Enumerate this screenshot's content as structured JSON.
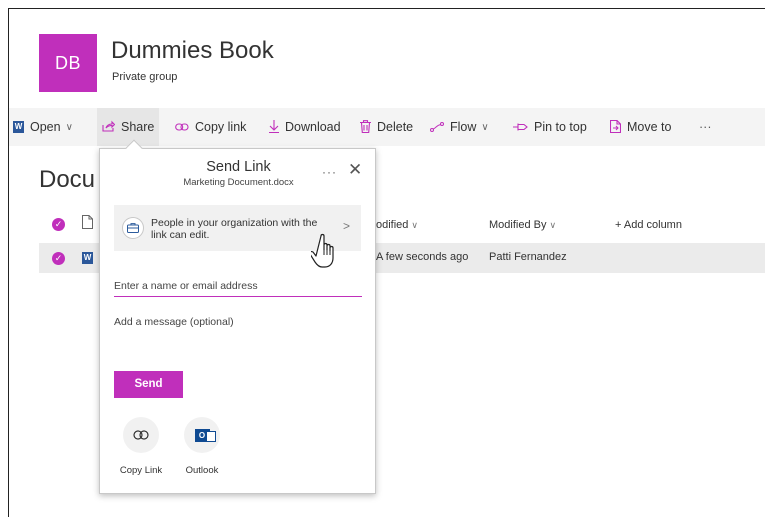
{
  "site": {
    "logo_initials": "DB",
    "title": "Dummies Book",
    "subtitle": "Private group",
    "brand_color": "#c02fbb"
  },
  "commandbar": {
    "open": {
      "label": "Open",
      "icon": "word-doc-icon"
    },
    "share": {
      "label": "Share",
      "icon": "share-icon"
    },
    "copy_link": {
      "label": "Copy link",
      "icon": "link-icon"
    },
    "download": {
      "label": "Download",
      "icon": "download-icon"
    },
    "delete": {
      "label": "Delete",
      "icon": "trash-icon"
    },
    "flow": {
      "label": "Flow",
      "icon": "flow-icon"
    },
    "pin": {
      "label": "Pin to top",
      "icon": "pin-icon"
    },
    "move": {
      "label": "Move to",
      "icon": "move-icon"
    },
    "more": "···"
  },
  "library": {
    "title_visible": "Docu",
    "columns": {
      "modified": "odified",
      "modified_by": "Modified By",
      "add_column": "+ Add column"
    },
    "rows": [
      {
        "modified": "A few seconds ago",
        "modified_by": "Patti Fernandez"
      }
    ]
  },
  "dialog": {
    "title": "Send Link",
    "file_name": "Marketing Document.docx",
    "more": "···",
    "close": "✕",
    "permission_text": "People in your organization with the link can edit.",
    "permission_chevron": ">",
    "name_placeholder": "Enter a name or email address",
    "message_placeholder": "Add a message (optional)",
    "send_label": "Send",
    "options": [
      {
        "label": "Copy Link",
        "icon": "link-icon"
      },
      {
        "label": "Outlook",
        "icon": "outlook-icon"
      }
    ]
  }
}
